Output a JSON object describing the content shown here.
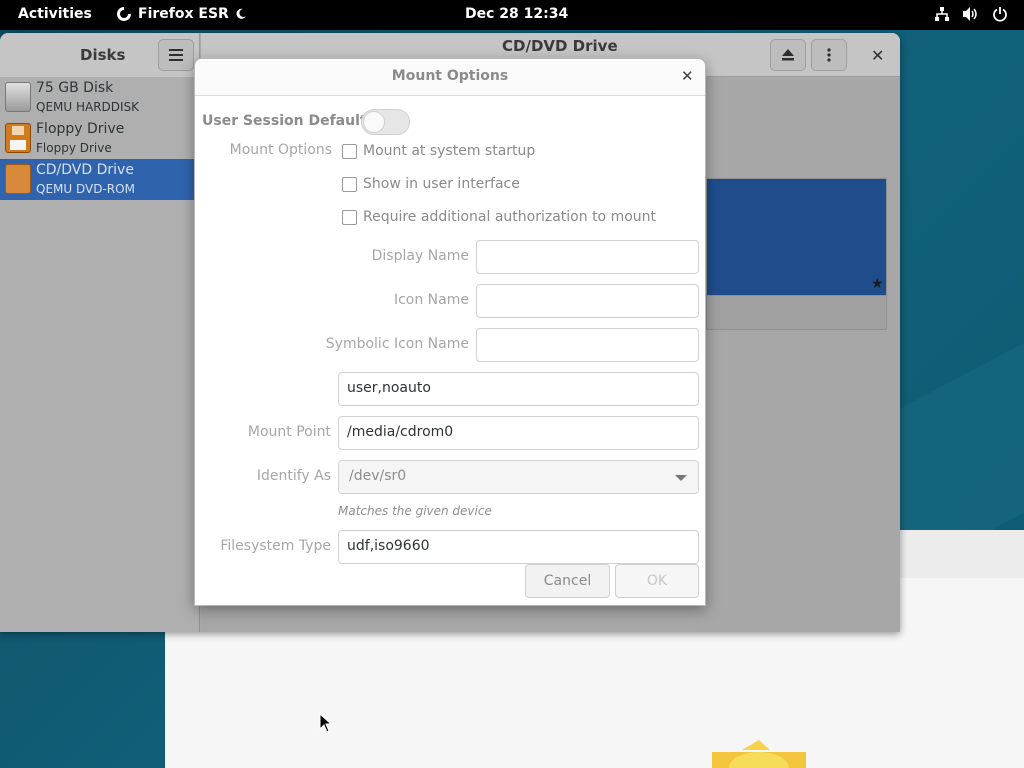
{
  "topbar": {
    "activities": "Activities",
    "app_name": "Firefox ESR",
    "clock": "Dec 28  12:34",
    "tray_icons": [
      "network-icon",
      "volume-icon",
      "power-icon"
    ]
  },
  "disks": {
    "title": "Disks",
    "drive_title": "CD/DVD Drive",
    "items": [
      {
        "name": "75 GB Disk",
        "sub": "QEMU HARDDISK",
        "icon": "harddisk-icon"
      },
      {
        "name": "Floppy Drive",
        "sub": "Floppy Drive",
        "icon": "floppy-icon"
      },
      {
        "name": "CD/DVD Drive",
        "sub": "QEMU DVD-ROM",
        "icon": "optical-drive-icon",
        "selected": true
      }
    ]
  },
  "dialog": {
    "title": "Mount Options",
    "user_session_defaults": "User Session Defaults",
    "user_session_defaults_on": false,
    "mount_options_label": "Mount Options",
    "checkboxes": [
      {
        "label": "Mount at system startup",
        "checked": false
      },
      {
        "label": "Show in user interface",
        "checked": false
      },
      {
        "label": "Require additional authorization to mount",
        "checked": false
      }
    ],
    "display_name_label": "Display Name",
    "display_name_value": "",
    "icon_name_label": "Icon Name",
    "icon_name_value": "",
    "symbolic_icon_name_label": "Symbolic Icon Name",
    "symbolic_icon_name_value": "",
    "options_value": "user,noauto",
    "mount_point_label": "Mount Point",
    "mount_point_value": "/media/cdrom0",
    "identify_as_label": "Identify As",
    "identify_as_value": "/dev/sr0",
    "identify_hint": "Matches the given device",
    "filesystem_type_label": "Filesystem Type",
    "filesystem_type_value": "udf,iso9660",
    "cancel": "Cancel",
    "ok": "OK"
  },
  "colors": {
    "selection": "#2f63ad",
    "topbar": "#000000",
    "desktop": "#0f4f63"
  }
}
